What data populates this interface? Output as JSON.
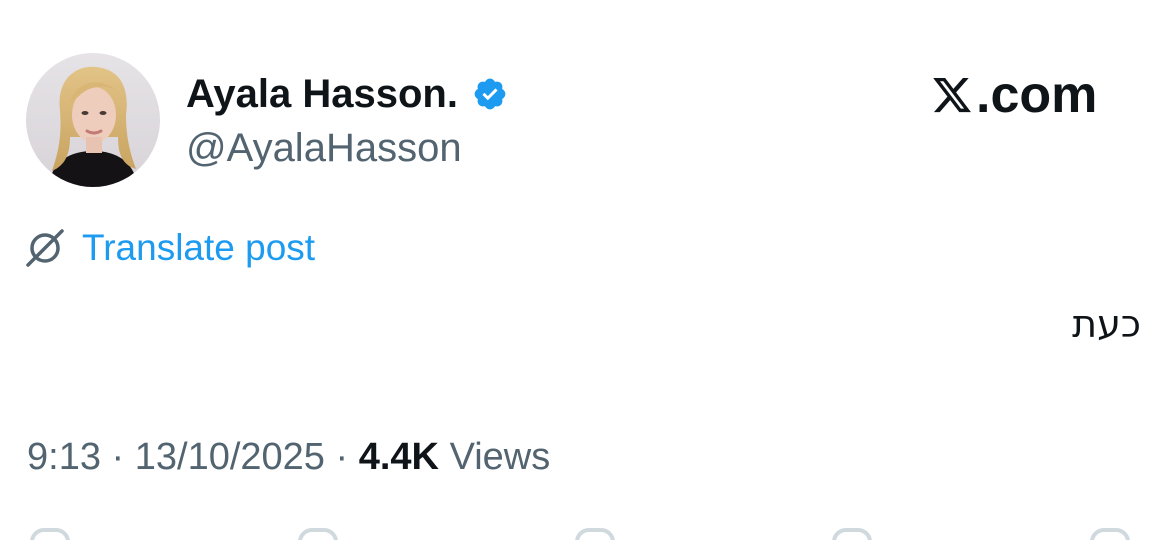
{
  "author": {
    "display_name": "Ayala Hasson.",
    "handle": "@AyalaHasson",
    "verified": true,
    "verified_color": "#1d9bf0"
  },
  "brand": {
    "logo_icon": "x-logo-icon",
    "domain_text": ".com"
  },
  "post": {
    "translate_label": "Translate post",
    "text": "כעת",
    "time": "9:13",
    "date": "13/10/2025",
    "separator": "·",
    "views_count": "4.4K",
    "views_label": "Views"
  },
  "colors": {
    "text_primary": "#0f1419",
    "text_secondary": "#536471",
    "link": "#1d9bf0"
  },
  "action_bar_icons": [
    "reply-icon",
    "repost-icon",
    "like-icon",
    "bookmark-icon",
    "share-icon"
  ]
}
